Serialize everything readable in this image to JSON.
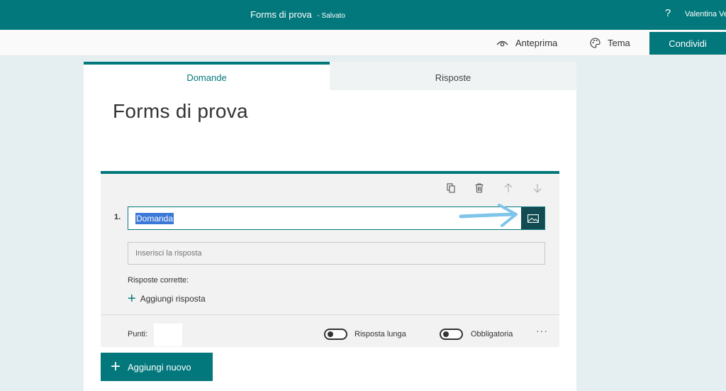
{
  "topbar": {
    "form_name": "Forms di prova",
    "status": "- Salvato",
    "help": "?",
    "user": "Valentina Ve"
  },
  "toolbar": {
    "preview": "Anteprima",
    "theme": "Tema",
    "share": "Condividi"
  },
  "tabs": {
    "questions": "Domande",
    "responses": "Risposte"
  },
  "form": {
    "title": "Forms di prova"
  },
  "question": {
    "number": "1.",
    "text": "Domanda",
    "answer_placeholder": "Inserisci la risposta",
    "correct_answers_label": "Risposte corrette:",
    "add_answer": "Aggiungi risposta",
    "points_label": "Punti:",
    "long_answer_label": "Risposta lunga",
    "required_label": "Obbligatoria",
    "more": "···"
  },
  "add_new": {
    "label": "Aggiungi nuovo"
  },
  "colors": {
    "accent": "#03787c",
    "image_button": "#124b51",
    "annotation_arrow": "#7fc4ea"
  }
}
